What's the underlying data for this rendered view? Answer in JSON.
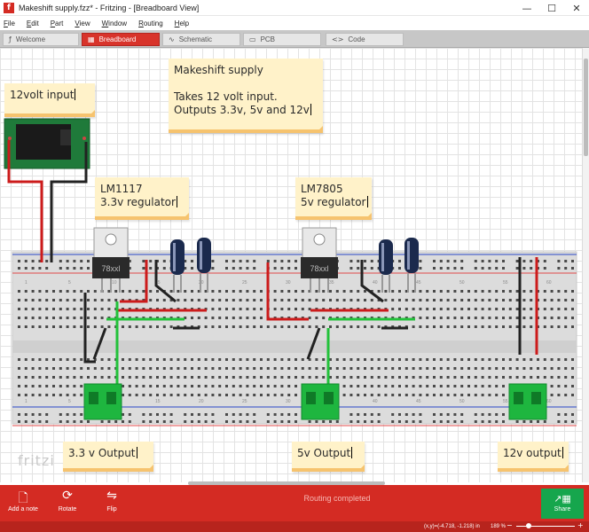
{
  "window": {
    "title": "Makeshift supply.fzz* - Fritzing - [Breadboard View]",
    "app_icon_letter": "f",
    "controls": {
      "minimize": "—",
      "maximize": "☐",
      "close": "✕"
    }
  },
  "menu": [
    {
      "label": "File",
      "mnemonic": "F",
      "rest": "ile"
    },
    {
      "label": "Edit",
      "mnemonic": "E",
      "rest": "dit"
    },
    {
      "label": "Part",
      "mnemonic": "P",
      "rest": "art"
    },
    {
      "label": "View",
      "mnemonic": "V",
      "rest": "iew"
    },
    {
      "label": "Window",
      "mnemonic": "W",
      "rest": "indow"
    },
    {
      "label": "Routing",
      "mnemonic": "R",
      "rest": "outing"
    },
    {
      "label": "Help",
      "mnemonic": "H",
      "rest": "elp"
    }
  ],
  "tabs": [
    {
      "label": "Welcome",
      "icon": "welcome-icon",
      "glyph": "ƒ",
      "active": false
    },
    {
      "label": "Breadboard",
      "icon": "breadboard-icon",
      "glyph": "▦",
      "active": true
    },
    {
      "label": "Schematic",
      "icon": "schematic-icon",
      "glyph": "∿",
      "active": false
    },
    {
      "label": "PCB",
      "icon": "pcb-icon",
      "glyph": "▭",
      "active": false
    },
    {
      "label": "Code",
      "icon": "code-icon",
      "glyph": "<>",
      "active": false
    }
  ],
  "notes": {
    "title_note": "Makeshift supply\n\nTakes 12 volt input.\nOutputs 3.3v, 5v and 12v",
    "input_note": "12volt input",
    "lm1117_note": "LM1117\n3.3v regulator",
    "lm7805_note": "LM7805\n5v regulator",
    "out33_note": "3.3 v Output",
    "out5_note": "5v Output",
    "out12_note": "12v output"
  },
  "parts": {
    "regulator_label": "78xxl",
    "breadboard_col_numbers": [
      "1",
      "5",
      "10",
      "15",
      "20",
      "25",
      "30",
      "35",
      "40",
      "45",
      "50",
      "55",
      "60"
    ]
  },
  "watermark": "fritzi",
  "toolbar": {
    "add_note": "Add a note",
    "rotate": "Rotate",
    "flip": "Flip",
    "share": "Share",
    "status": "Routing completed"
  },
  "statusbar": {
    "coords": "(x,y)=(-4.718, -1.218) in",
    "zoom": "189 %",
    "zoom_minus": "−",
    "zoom_plus": "+"
  },
  "colors": {
    "accent_red": "#d42b23",
    "share_green": "#16a64d",
    "note_bg": "#fff2c9",
    "note_fold": "#f6c36e",
    "wire_red": "#cc1b1b",
    "wire_black": "#222222",
    "wire_green": "#22c23a"
  }
}
